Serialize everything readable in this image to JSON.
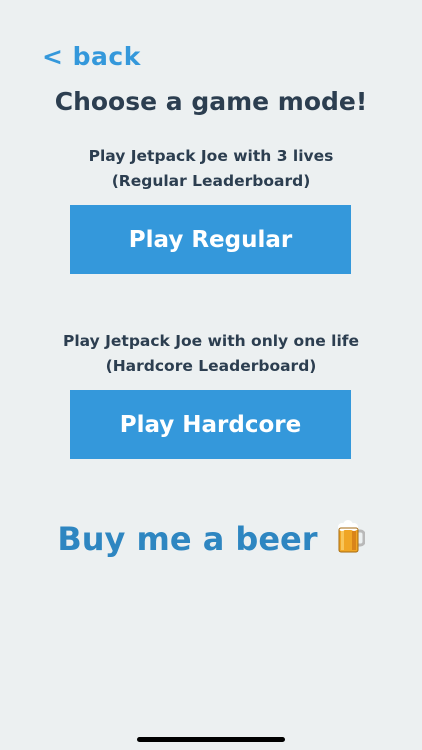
{
  "nav": {
    "back_label": "< back"
  },
  "title": "Choose a game mode!",
  "regular": {
    "line1": "Play Jetpack Joe with 3 lives",
    "line2": "(Regular Leaderboard)",
    "button_label": "Play Regular"
  },
  "hardcore": {
    "line1": "Play Jetpack Joe with only one life",
    "line2": "(Hardcore Leaderboard)",
    "button_label": "Play Hardcore"
  },
  "support": {
    "label": "Buy me a beer",
    "icon": "beer-mug-icon"
  },
  "colors": {
    "background": "#ecf0f1",
    "accent": "#3498db",
    "text": "#2c3e50",
    "button_text": "#ffffff"
  }
}
